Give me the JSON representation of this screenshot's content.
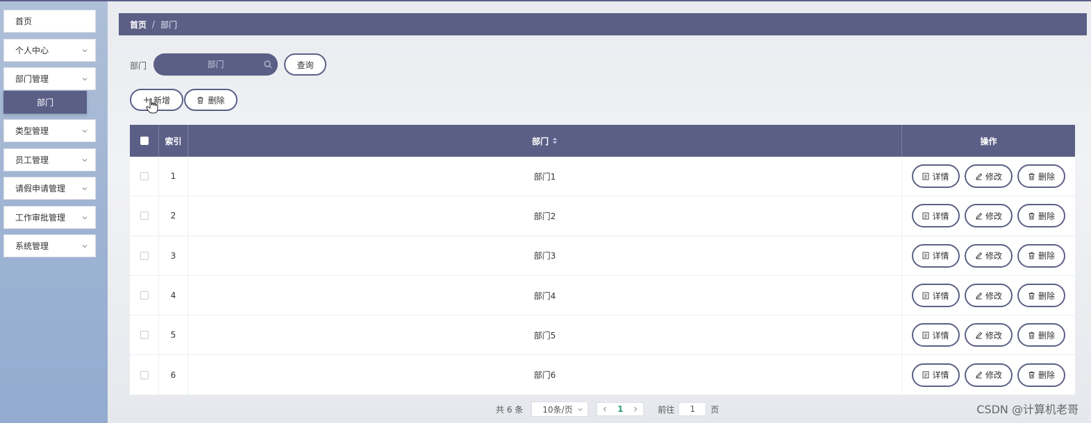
{
  "sidebar": {
    "items": [
      {
        "label": "首页",
        "has_chevron": false
      },
      {
        "label": "个人中心",
        "has_chevron": true
      },
      {
        "label": "部门管理",
        "has_chevron": true
      },
      {
        "label": "类型管理",
        "has_chevron": true
      },
      {
        "label": "员工管理",
        "has_chevron": true
      },
      {
        "label": "请假申请管理",
        "has_chevron": true
      },
      {
        "label": "工作审批管理",
        "has_chevron": true
      },
      {
        "label": "系统管理",
        "has_chevron": true
      }
    ],
    "active_sub": "部门"
  },
  "breadcrumb": {
    "home": "首页",
    "separator": "/",
    "current": "部门"
  },
  "search": {
    "label": "部门",
    "placeholder": "部门",
    "query_button": "查询"
  },
  "actions": {
    "add": "新增",
    "delete": "删除"
  },
  "table": {
    "headers": {
      "index": "索引",
      "department": "部门",
      "operations": "操作"
    },
    "rows": [
      {
        "index": "1",
        "department": "部门1"
      },
      {
        "index": "2",
        "department": "部门2"
      },
      {
        "index": "3",
        "department": "部门3"
      },
      {
        "index": "4",
        "department": "部门4"
      },
      {
        "index": "5",
        "department": "部门5"
      },
      {
        "index": "6",
        "department": "部门6"
      }
    ],
    "row_actions": {
      "detail": "详情",
      "edit": "修改",
      "delete": "删除"
    }
  },
  "pagination": {
    "total": "共 6 条",
    "page_size": "10条/页",
    "current_page": "1",
    "goto_label": "前往",
    "goto_value": "1",
    "page_suffix": "页"
  },
  "watermark": "CSDN @计算机老哥",
  "colors": {
    "primary": "#5b5f86",
    "page_active": "#2c9c76"
  }
}
